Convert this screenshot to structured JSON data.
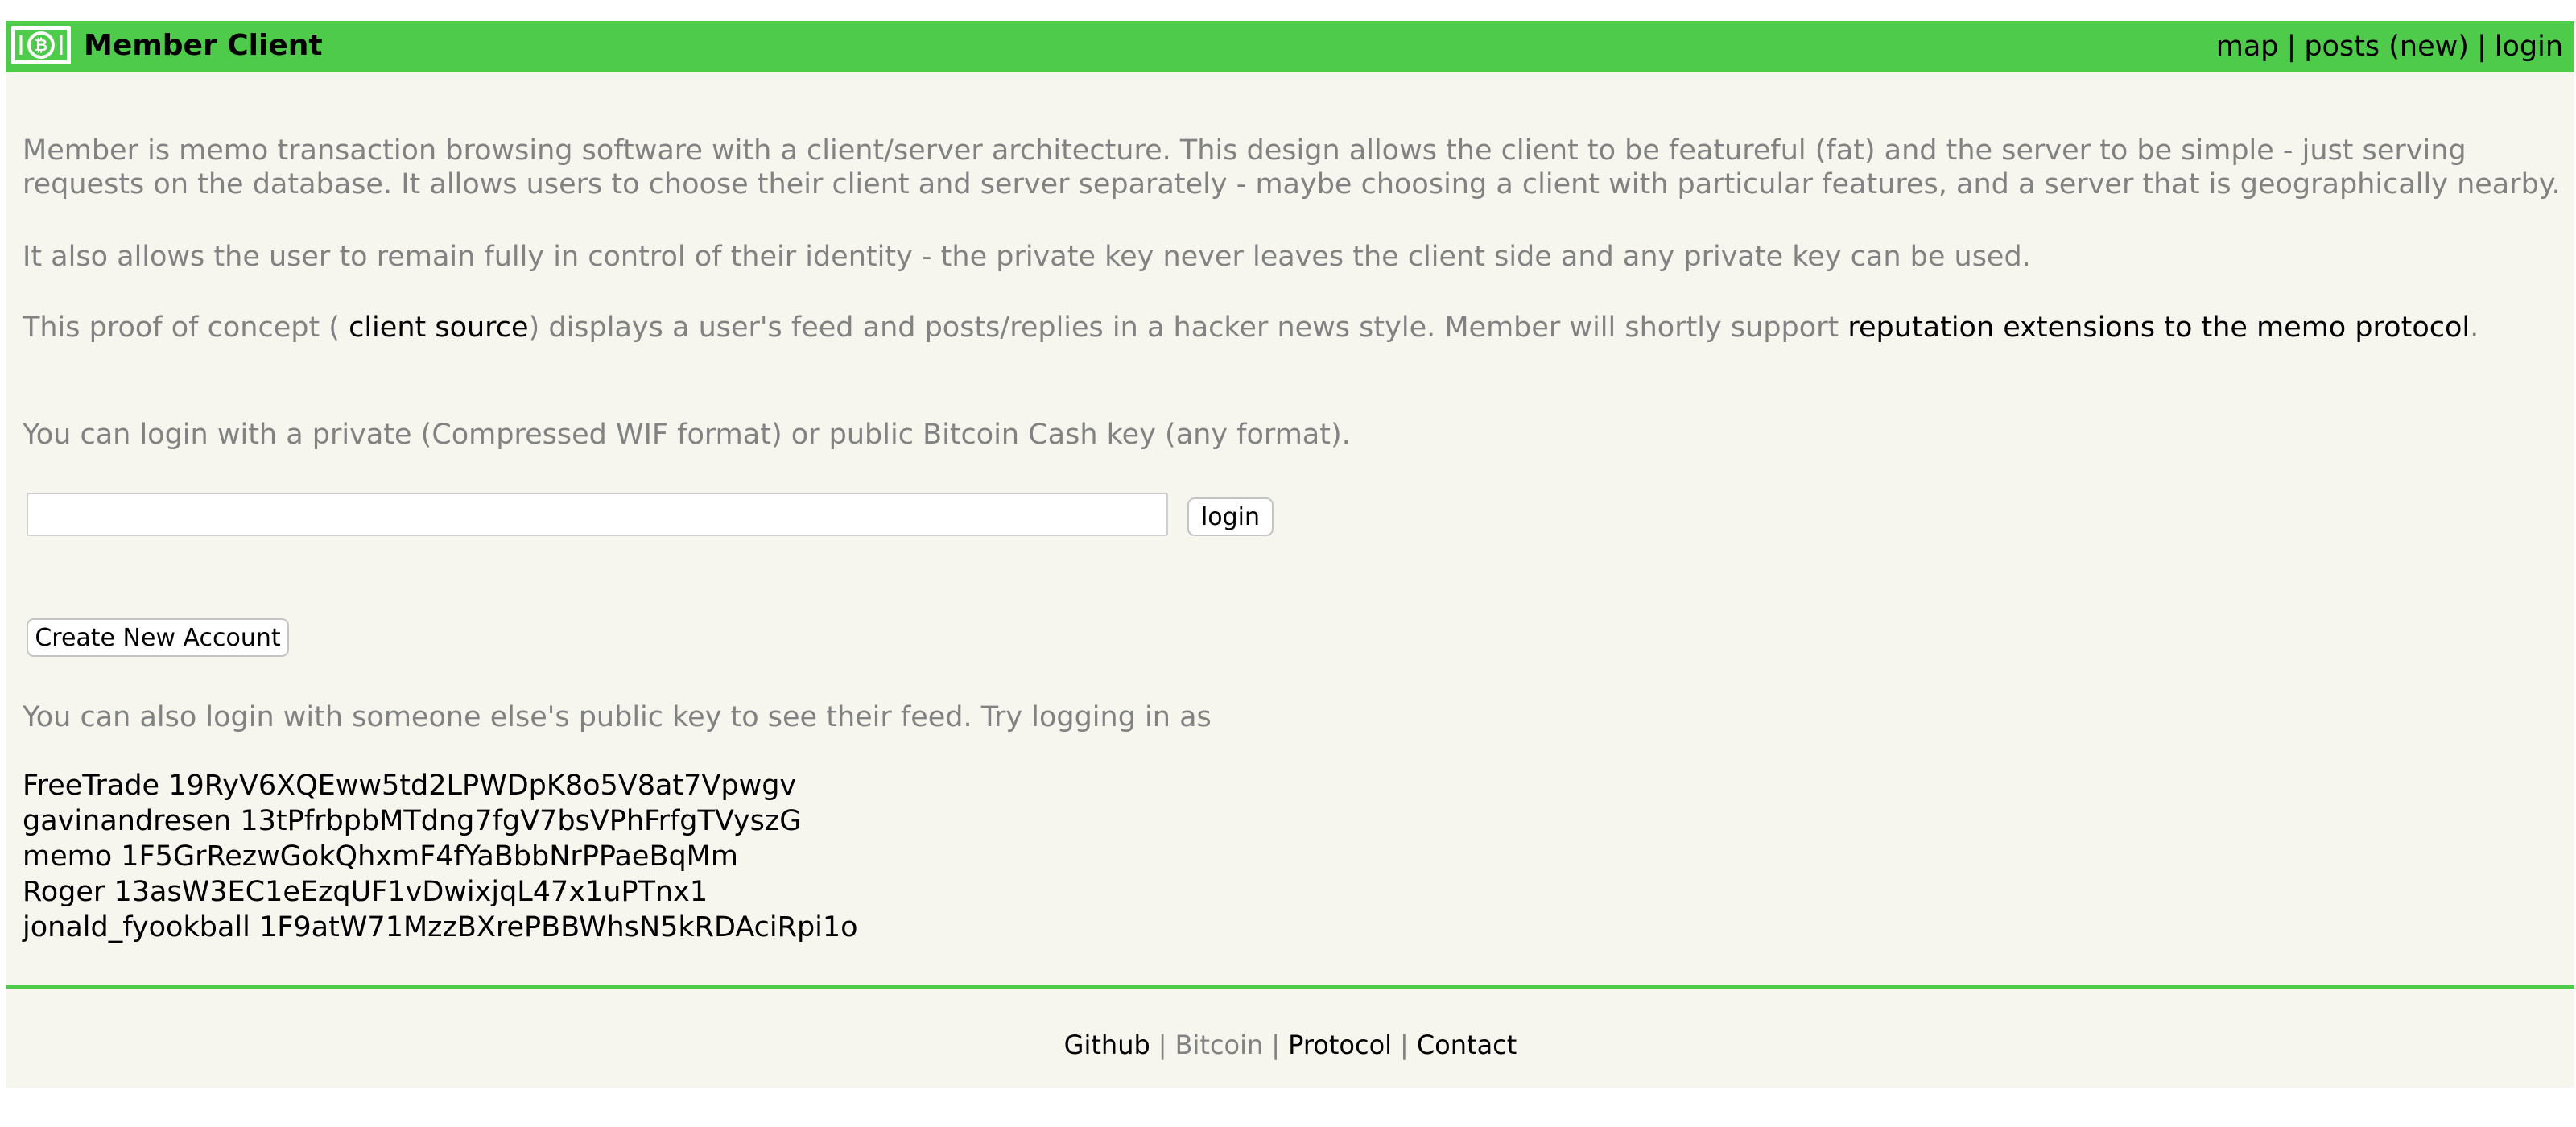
{
  "header": {
    "logo_icon": "bitcoin-cash-logo-icon",
    "title": "Member Client",
    "nav": {
      "map": "map",
      "posts_new": "posts (new)",
      "login": "login",
      "separator": "|"
    },
    "accent_color": "#4ecb4a"
  },
  "intro": {
    "p1_line1": "Member is memo transaction browsing software with a client/server architecture. This design allows the client to be featureful (fat) and the server to be simple - just serving",
    "p1_line2": "requests on the database. It allows users to choose their client and server separately - maybe choosing a client with particular features, and a server that is geographically nearby.",
    "p2": "It also allows the user to remain fully in control of their identity - the private key never leaves the client side and any private key can be used.",
    "p3_before": "This proof of concept ( ",
    "p3_link1": "client source",
    "p3_middle": ") displays a user's feed and posts/replies in a hacker news style. Member will shortly support ",
    "p3_link2": "reputation extensions to the memo protocol",
    "p3_end": "."
  },
  "login": {
    "instructions": "You can login with a private (Compressed WIF format) or public Bitcoin Cash key (any format).",
    "input_value": "",
    "button_label": "login",
    "create_account_label": "Create New Account",
    "try_text": "You can also login with someone else's public key to see their feed. Try logging in as"
  },
  "accounts": [
    {
      "name": "FreeTrade",
      "key": "19RyV6XQEww5td2LPWDpK8o5V8at7Vpwgv"
    },
    {
      "name": "gavinandresen",
      "key": "13tPfrbpbMTdng7fgV7bsVPhFrfgTVyszG"
    },
    {
      "name": "memo",
      "key": "1F5GrRezwGokQhxmF4fYaBbbNrPPaeBqMm"
    },
    {
      "name": "Roger",
      "key": "13asW3EC1eEzqUF1vDwixjqL47x1uPTnx1"
    },
    {
      "name": "jonald_fyookball",
      "key": "1F9atW71MzzBXrePBBWhsN5kRDAciRpi1o"
    }
  ],
  "footer": {
    "github": "Github",
    "bitcoin": "Bitcoin",
    "protocol": "Protocol",
    "contact": "Contact",
    "separator": "|"
  }
}
